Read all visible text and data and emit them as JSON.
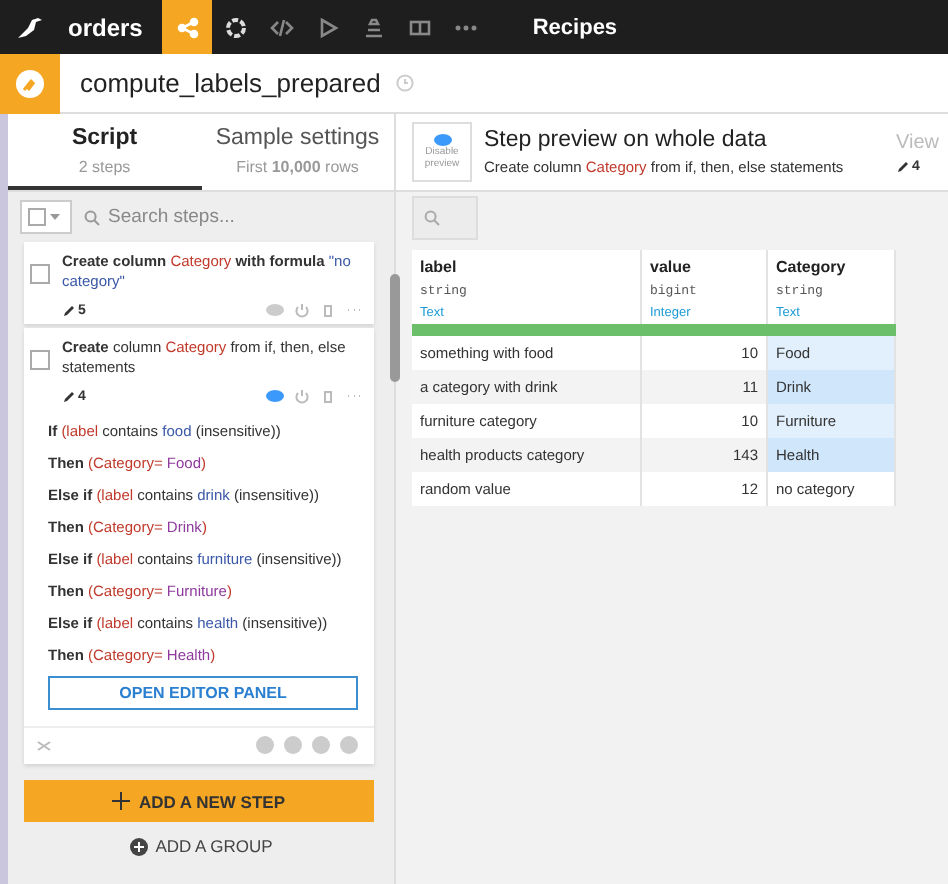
{
  "topbar": {
    "project": "orders",
    "nav": [
      {
        "kind": "flow",
        "selected": true
      },
      {
        "kind": "cycle",
        "selected": false
      },
      {
        "kind": "code",
        "selected": false
      },
      {
        "kind": "run",
        "selected": false
      },
      {
        "kind": "stack",
        "selected": false
      },
      {
        "kind": "dashboard",
        "selected": false
      },
      {
        "kind": "more",
        "selected": false
      }
    ],
    "section": "Recipes"
  },
  "recipe": {
    "name": "compute_labels_prepared"
  },
  "tabs": [
    {
      "label": "Script",
      "sub": "2 steps",
      "selected": true
    },
    {
      "label": "Sample settings",
      "sub": "First **10,000** rows",
      "selected": false
    }
  ],
  "search": {
    "placeholder": "Search steps..."
  },
  "steps": [
    {
      "title": [
        {
          "kind": "verb",
          "text": "Create column "
        },
        {
          "kind": "column",
          "text": "Category"
        },
        {
          "kind": "verb",
          "text": " with formula "
        },
        {
          "kind": "value",
          "text": "\"no category\""
        }
      ],
      "count": "5",
      "checked": false,
      "preview": false
    },
    {
      "title": [
        {
          "kind": "verb",
          "text": "Create "
        },
        {
          "kind": "text",
          "text": "column "
        },
        {
          "kind": "column",
          "text": "Category"
        },
        {
          "kind": "text",
          "text": " from if, then, else statements"
        }
      ],
      "count": "4",
      "checked": false,
      "preview": true,
      "rules": [
        {
          "keyword": "If",
          "parts": [
            {
              "kind": "column",
              "text": "(label"
            },
            {
              "kind": "text",
              "text": " contains "
            },
            {
              "kind": "value",
              "text": "food"
            },
            {
              "kind": "text",
              "text": " (insensitive))"
            }
          ]
        },
        {
          "keyword": "Then",
          "parts": [
            {
              "kind": "column",
              "text": "(Category= "
            },
            {
              "kind": "result",
              "text": "Food"
            },
            {
              "kind": "column",
              "text": ")"
            }
          ]
        },
        {
          "keyword": "Else if",
          "parts": [
            {
              "kind": "column",
              "text": "(label"
            },
            {
              "kind": "text",
              "text": " contains "
            },
            {
              "kind": "value",
              "text": "drink"
            },
            {
              "kind": "text",
              "text": " (insensitive))"
            }
          ]
        },
        {
          "keyword": "Then",
          "parts": [
            {
              "kind": "column",
              "text": "(Category= "
            },
            {
              "kind": "result",
              "text": "Drink"
            },
            {
              "kind": "column",
              "text": ")"
            }
          ]
        },
        {
          "keyword": "Else if",
          "parts": [
            {
              "kind": "column",
              "text": "(label"
            },
            {
              "kind": "text",
              "text": " contains "
            },
            {
              "kind": "value",
              "text": "furniture"
            },
            {
              "kind": "text",
              "text": " (insensitive))"
            }
          ]
        },
        {
          "keyword": "Then",
          "parts": [
            {
              "kind": "column",
              "text": "(Category= "
            },
            {
              "kind": "result",
              "text": "Furniture"
            },
            {
              "kind": "column",
              "text": ")"
            }
          ]
        },
        {
          "keyword": "Else if",
          "parts": [
            {
              "kind": "column",
              "text": "(label"
            },
            {
              "kind": "text",
              "text": " contains "
            },
            {
              "kind": "value",
              "text": "health"
            },
            {
              "kind": "text",
              "text": " (insensitive))"
            }
          ]
        },
        {
          "keyword": "Then",
          "parts": [
            {
              "kind": "column",
              "text": "(Category= "
            },
            {
              "kind": "result",
              "text": "Health"
            },
            {
              "kind": "column",
              "text": ")"
            }
          ]
        }
      ],
      "editor_button": "OPEN EDITOR PANEL"
    }
  ],
  "add_step": "ADD A NEW STEP",
  "add_group": "ADD A GROUP",
  "preview": {
    "toggle": "Disable preview",
    "title": "Step preview on whole data",
    "subtitle": [
      {
        "kind": "text",
        "text": "Create column "
      },
      {
        "kind": "column",
        "text": "Category"
      },
      {
        "kind": "text",
        "text": " from if, then, else statements"
      }
    ],
    "view": "View",
    "count": "4"
  },
  "table": {
    "columns": [
      {
        "name": "label",
        "type": "string",
        "meaning": "Text",
        "numeric": false
      },
      {
        "name": "value",
        "type": "bigint",
        "meaning": "Integer",
        "numeric": true
      },
      {
        "name": "Category",
        "type": "string",
        "meaning": "Text",
        "numeric": false
      }
    ],
    "rows": [
      {
        "cells": [
          "something with food",
          "10",
          "Food"
        ],
        "changed": true
      },
      {
        "cells": [
          "a category with drink",
          "11",
          "Drink"
        ],
        "changed": true
      },
      {
        "cells": [
          "furniture category",
          "10",
          "Furniture"
        ],
        "changed": true
      },
      {
        "cells": [
          "health products category",
          "143",
          "Health"
        ],
        "changed": true
      },
      {
        "cells": [
          "random value",
          "12",
          "no category"
        ],
        "changed": false
      }
    ]
  }
}
